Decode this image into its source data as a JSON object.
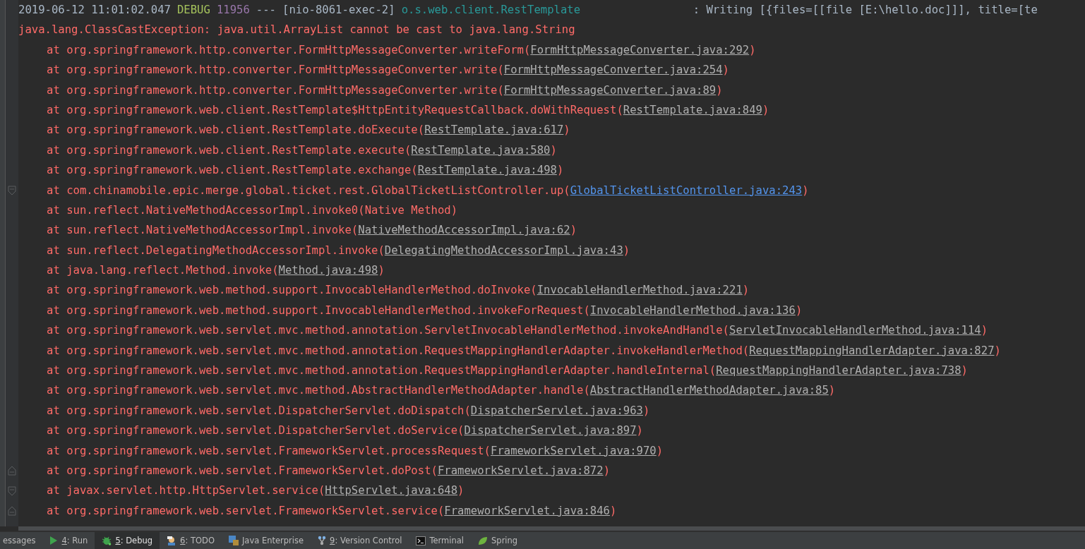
{
  "log": {
    "header": {
      "timestamp": "2019-06-12 11:01:02.047",
      "level": "DEBUG",
      "pid": "11956",
      "separator": "---",
      "thread": "[nio-8061-exec-2]",
      "logger": "o.s.web.client.RestTemplate",
      "message": ": Writing [{files=[[file [E:\\hello.doc]]], title=[te"
    },
    "exception": "java.lang.ClassCastException: java.util.ArrayList cannot be cast to java.lang.String",
    "frames": [
      {
        "kind": "link",
        "prefix": "at org.springframework.http.converter.FormHttpMessageConverter.writeForm(",
        "source": "FormHttpMessageConverter.java:292",
        "suffix": ")",
        "user_code": false,
        "fold_start": false,
        "fold_end": false
      },
      {
        "kind": "link",
        "prefix": "at org.springframework.http.converter.FormHttpMessageConverter.write(",
        "source": "FormHttpMessageConverter.java:254",
        "suffix": ")",
        "user_code": false,
        "fold_start": false,
        "fold_end": false
      },
      {
        "kind": "link",
        "prefix": "at org.springframework.http.converter.FormHttpMessageConverter.write(",
        "source": "FormHttpMessageConverter.java:89",
        "suffix": ")",
        "user_code": false,
        "fold_start": false,
        "fold_end": false
      },
      {
        "kind": "link",
        "prefix": "at org.springframework.web.client.RestTemplate$HttpEntityRequestCallback.doWithRequest(",
        "source": "RestTemplate.java:849",
        "suffix": ")",
        "user_code": false,
        "fold_start": false,
        "fold_end": false
      },
      {
        "kind": "link",
        "prefix": "at org.springframework.web.client.RestTemplate.doExecute(",
        "source": "RestTemplate.java:617",
        "suffix": ")",
        "user_code": false,
        "fold_start": false,
        "fold_end": false
      },
      {
        "kind": "link",
        "prefix": "at org.springframework.web.client.RestTemplate.execute(",
        "source": "RestTemplate.java:580",
        "suffix": ")",
        "user_code": false,
        "fold_start": false,
        "fold_end": false
      },
      {
        "kind": "link",
        "prefix": "at org.springframework.web.client.RestTemplate.exchange(",
        "source": "RestTemplate.java:498",
        "suffix": ")",
        "user_code": false,
        "fold_start": false,
        "fold_end": false
      },
      {
        "kind": "link",
        "prefix": "at com.chinamobile.epic.merge.global.ticket.rest.GlobalTicketListController.up(",
        "source": "GlobalTicketListController.java:243",
        "suffix": ")",
        "user_code": true,
        "fold_start": true,
        "fold_end": false
      },
      {
        "kind": "native",
        "text": "at sun.reflect.NativeMethodAccessorImpl.invoke0(Native Method)",
        "fold_start": false,
        "fold_end": false
      },
      {
        "kind": "link",
        "prefix": "at sun.reflect.NativeMethodAccessorImpl.invoke(",
        "source": "NativeMethodAccessorImpl.java:62",
        "suffix": ")",
        "user_code": false,
        "fold_start": false,
        "fold_end": false
      },
      {
        "kind": "link",
        "prefix": "at sun.reflect.DelegatingMethodAccessorImpl.invoke(",
        "source": "DelegatingMethodAccessorImpl.java:43",
        "suffix": ")",
        "user_code": false,
        "fold_start": false,
        "fold_end": false
      },
      {
        "kind": "link",
        "prefix": "at java.lang.reflect.Method.invoke(",
        "source": "Method.java:498",
        "suffix": ")",
        "user_code": false,
        "fold_start": false,
        "fold_end": false
      },
      {
        "kind": "link",
        "prefix": "at org.springframework.web.method.support.InvocableHandlerMethod.doInvoke(",
        "source": "InvocableHandlerMethod.java:221",
        "suffix": ")",
        "user_code": false,
        "fold_start": false,
        "fold_end": false
      },
      {
        "kind": "link",
        "prefix": "at org.springframework.web.method.support.InvocableHandlerMethod.invokeForRequest(",
        "source": "InvocableHandlerMethod.java:136",
        "suffix": ")",
        "user_code": false,
        "fold_start": false,
        "fold_end": false
      },
      {
        "kind": "link",
        "prefix": "at org.springframework.web.servlet.mvc.method.annotation.ServletInvocableHandlerMethod.invokeAndHandle(",
        "source": "ServletInvocableHandlerMethod.java:114",
        "suffix": ")",
        "user_code": false,
        "fold_start": false,
        "fold_end": false
      },
      {
        "kind": "link",
        "prefix": "at org.springframework.web.servlet.mvc.method.annotation.RequestMappingHandlerAdapter.invokeHandlerMethod(",
        "source": "RequestMappingHandlerAdapter.java:827",
        "suffix": ")",
        "user_code": false,
        "fold_start": false,
        "fold_end": false
      },
      {
        "kind": "link",
        "prefix": "at org.springframework.web.servlet.mvc.method.annotation.RequestMappingHandlerAdapter.handleInternal(",
        "source": "RequestMappingHandlerAdapter.java:738",
        "suffix": ")",
        "user_code": false,
        "fold_start": false,
        "fold_end": false
      },
      {
        "kind": "link",
        "prefix": "at org.springframework.web.servlet.mvc.method.AbstractHandlerMethodAdapter.handle(",
        "source": "AbstractHandlerMethodAdapter.java:85",
        "suffix": ")",
        "user_code": false,
        "fold_start": false,
        "fold_end": false
      },
      {
        "kind": "link",
        "prefix": "at org.springframework.web.servlet.DispatcherServlet.doDispatch(",
        "source": "DispatcherServlet.java:963",
        "suffix": ")",
        "user_code": false,
        "fold_start": false,
        "fold_end": false
      },
      {
        "kind": "link",
        "prefix": "at org.springframework.web.servlet.DispatcherServlet.doService(",
        "source": "DispatcherServlet.java:897",
        "suffix": ")",
        "user_code": false,
        "fold_start": false,
        "fold_end": false
      },
      {
        "kind": "link",
        "prefix": "at org.springframework.web.servlet.FrameworkServlet.processRequest(",
        "source": "FrameworkServlet.java:970",
        "suffix": ")",
        "user_code": false,
        "fold_start": false,
        "fold_end": false
      },
      {
        "kind": "link",
        "prefix": "at org.springframework.web.servlet.FrameworkServlet.doPost(",
        "source": "FrameworkServlet.java:872",
        "suffix": ")",
        "user_code": false,
        "fold_start": false,
        "fold_end": true
      },
      {
        "kind": "link",
        "prefix": "at javax.servlet.http.HttpServlet.service(",
        "source": "HttpServlet.java:648",
        "suffix": ")",
        "user_code": false,
        "fold_start": true,
        "fold_end": false
      },
      {
        "kind": "link",
        "prefix": "at org.springframework.web.servlet.FrameworkServlet.service(",
        "source": "FrameworkServlet.java:846",
        "suffix": ")",
        "user_code": false,
        "fold_start": false,
        "fold_end": true
      }
    ]
  },
  "tool_tabs": [
    {
      "kind": "messages",
      "label": "essages",
      "mnemonic": false,
      "selected": false
    },
    {
      "kind": "run",
      "label": "4: Run",
      "mnemonic": true,
      "selected": false
    },
    {
      "kind": "debug",
      "label": "5: Debug",
      "mnemonic": true,
      "selected": true
    },
    {
      "kind": "todo",
      "label": "6: TODO",
      "mnemonic": true,
      "selected": false
    },
    {
      "kind": "enterprise",
      "label": "Java Enterprise",
      "mnemonic": false,
      "selected": false
    },
    {
      "kind": "vcs",
      "label": "9: Version Control",
      "mnemonic": true,
      "selected": false
    },
    {
      "kind": "terminal",
      "label": "Terminal",
      "mnemonic": false,
      "selected": false
    },
    {
      "kind": "spring",
      "label": "Spring",
      "mnemonic": false,
      "selected": false
    }
  ]
}
